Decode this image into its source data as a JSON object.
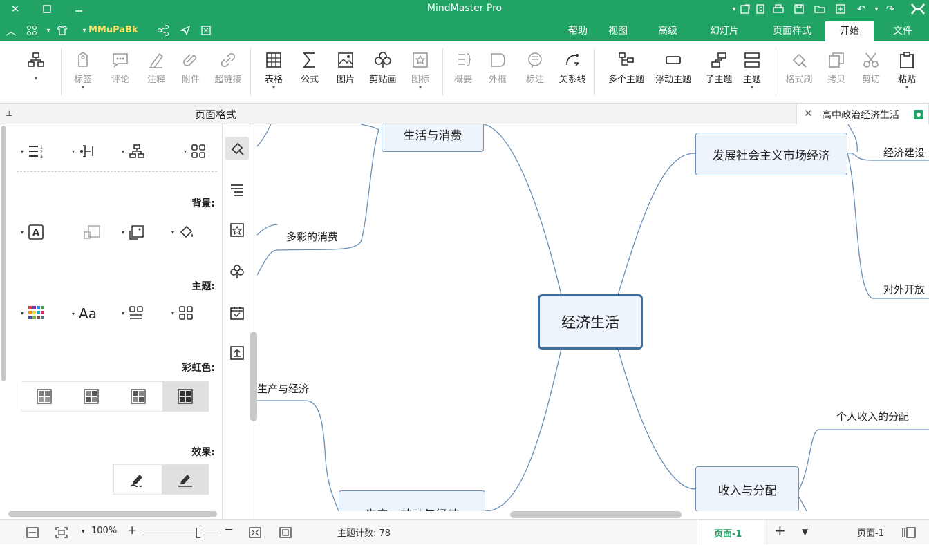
{
  "app": {
    "title": "MindMaster Pro"
  },
  "titlebar": {
    "close_icon": "close-icon",
    "restore_icon": "restore-icon",
    "minimize_icon": "minimize-icon"
  },
  "quickbar": {
    "user_label": "MMuPaBk"
  },
  "tabs": [
    {
      "label": "文件"
    },
    {
      "label": "开始"
    },
    {
      "label": "页面样式"
    },
    {
      "label": "幻灯片"
    },
    {
      "label": "高级"
    },
    {
      "label": "视图"
    },
    {
      "label": "帮助"
    }
  ],
  "ribbon": {
    "paste": "粘贴",
    "cut": "剪切",
    "copy": "拷贝",
    "format_painter": "格式刷",
    "topic": "主题",
    "subtopic": "子主题",
    "floating_topic": "浮动主题",
    "multiple_topics": "多个主题",
    "relationship": "关系线",
    "callout": "标注",
    "boundary": "外框",
    "summary": "概要",
    "icon": "图标",
    "clipart": "剪贴画",
    "image": "图片",
    "formula": "公式",
    "table": "表格",
    "hyperlink": "超链接",
    "attachment": "附件",
    "note": "注释",
    "comment": "评论",
    "tag": "标签"
  },
  "document": {
    "tab_title": "高中政治经济生活"
  },
  "panel": {
    "title": "页面格式",
    "background_label": "背景:",
    "theme_label": "主题:",
    "rainbow_label": "彩虹色:",
    "effect_label": "效果:"
  },
  "mindmap": {
    "central": "经济生活",
    "topics": {
      "top_left": "生活与消费",
      "top_right": "发展社会主义市场经济",
      "bottom_right": "收入与分配",
      "bottom_left": "生产、劳动与经营"
    },
    "leaves": {
      "diverse_consumption": "多彩的消费",
      "economic_construction": "经济建设",
      "opening_up": "对外开放",
      "personal_income": "个人收入的分配",
      "production_and_economy": "生产与经济"
    }
  },
  "status": {
    "page_left": "页面-1",
    "page_active": "页面-1",
    "topic_count": "主题计数: 78",
    "zoom": "100%"
  }
}
